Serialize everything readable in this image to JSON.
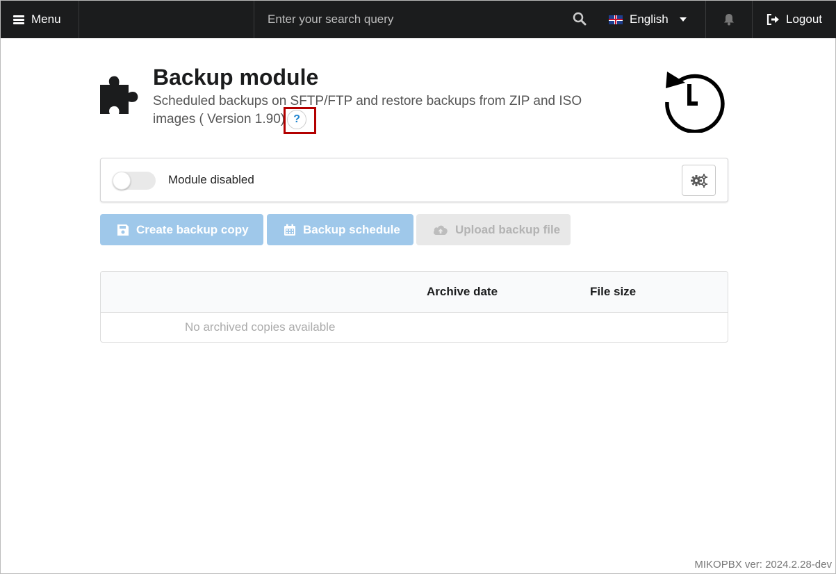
{
  "topbar": {
    "menu_label": "Menu",
    "search_placeholder": "Enter your search query",
    "language": "English",
    "logout_label": "Logout"
  },
  "header": {
    "title": "Backup module",
    "description": "Scheduled backups on SFTP/FTP and restore backups from ZIP and ISO images ( Version 1.90)",
    "help_label": "?"
  },
  "module": {
    "status_label": "Module disabled",
    "enabled": false
  },
  "actions": {
    "create_label": "Create backup copy",
    "schedule_label": "Backup schedule",
    "upload_label": "Upload backup file"
  },
  "table": {
    "columns": [
      "",
      "Archive date",
      "File size"
    ],
    "empty_message": "No archived copies available"
  },
  "footer": {
    "version": "MIKOPBX ver: 2024.2.28-dev"
  },
  "colors": {
    "topbar_bg": "#1b1c1d",
    "primary_disabled": "#9fc8ea",
    "help_accent": "#2185d0",
    "highlight": "#b30000"
  }
}
